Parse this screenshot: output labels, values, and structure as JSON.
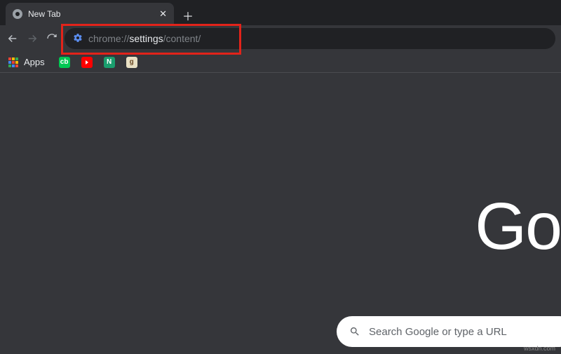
{
  "tab": {
    "title": "New Tab"
  },
  "address": {
    "prefix": "chrome://",
    "highlight": "settings",
    "suffix": "/content/"
  },
  "bookmarks_bar": {
    "apps_label": "Apps"
  },
  "page": {
    "logo_fragment": "Go",
    "search_placeholder": "Search Google or type a URL"
  },
  "watermark": "wsxdn.com"
}
